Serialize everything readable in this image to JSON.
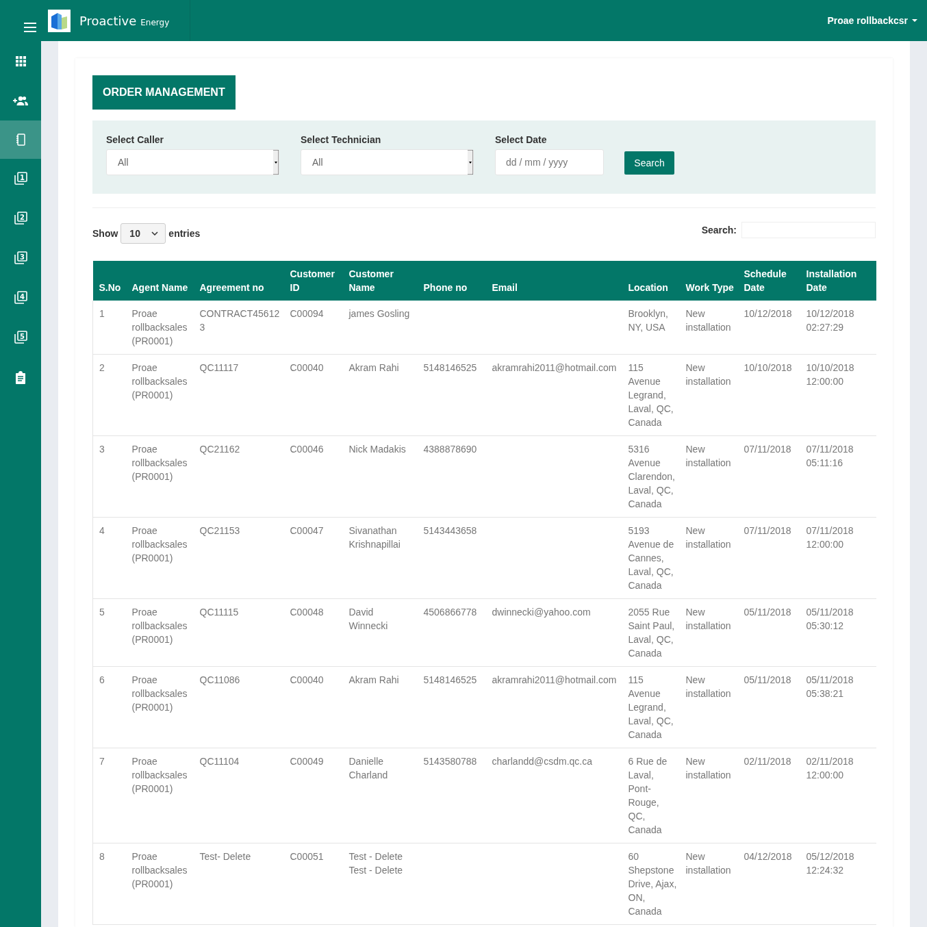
{
  "brand": {
    "name": "Proactive",
    "sub": "Energy"
  },
  "user": {
    "name": "Proae rollbackcsr"
  },
  "sidebar": {
    "items": [
      {
        "kind": "grid",
        "selected": false
      },
      {
        "kind": "people",
        "selected": false
      },
      {
        "kind": "notebook",
        "selected": true
      },
      {
        "kind": "numbered",
        "number": "1",
        "selected": false
      },
      {
        "kind": "numbered",
        "number": "2",
        "selected": false
      },
      {
        "kind": "numbered",
        "number": "3",
        "selected": false
      },
      {
        "kind": "numbered",
        "number": "4",
        "selected": false
      },
      {
        "kind": "numbered",
        "number": "5",
        "selected": false
      },
      {
        "kind": "clipboard",
        "selected": false
      }
    ]
  },
  "page_title": "ORDER MANAGEMENT",
  "filters": {
    "caller": {
      "label": "Select Caller",
      "value": "All"
    },
    "technician": {
      "label": "Select Technician",
      "value": "All"
    },
    "date": {
      "label": "Select Date",
      "placeholder": "dd / mm / yyyy"
    },
    "button": "Search"
  },
  "length": {
    "show": "Show",
    "value": "10",
    "entries": "entries"
  },
  "search": {
    "label": "Search:"
  },
  "table": {
    "columns": [
      "S.No",
      "Agent Name",
      "Agreement no",
      "Customer ID",
      "Customer Name",
      "Phone no",
      "Email",
      "Location",
      "Work Type",
      "Schedule Date",
      "Installation Date"
    ],
    "rows": [
      {
        "sno": "1",
        "agent": "Proae rollbacksales (PR0001)",
        "agreement": "CONTRACT456123",
        "customer_id": "C00094",
        "customer_name": "james Gosling",
        "location": "Brooklyn, NY, USA",
        "work_type": "New installation",
        "schedule": "10/12/2018",
        "installation": "10/12/2018 02:27:29"
      },
      {
        "sno": "2",
        "agent": "Proae rollbacksales (PR0001)",
        "agreement": "QC11117",
        "customer_id": "C00040",
        "customer_name": "Akram Rahi",
        "phone": "5148146525",
        "email": "akramrahi2011@hotmail.com",
        "location": "115 Avenue Legrand, Laval, QC, Canada",
        "work_type": "New installation",
        "schedule": "10/10/2018",
        "installation": "10/10/2018 12:00:00"
      },
      {
        "sno": "3",
        "agent": "Proae rollbacksales (PR0001)",
        "agreement": "QC21162",
        "customer_id": "C00046",
        "customer_name": "Nick Madakis",
        "phone": "4388878690",
        "location": "5316 Avenue Clarendon, Laval, QC, Canada",
        "work_type": "New installation",
        "schedule": "07/11/2018",
        "installation": "07/11/2018 05:11:16"
      },
      {
        "sno": "4",
        "agent": "Proae rollbacksales (PR0001)",
        "agreement": "QC21153",
        "customer_id": "C00047",
        "customer_name": "Sivanathan Krishnapillai",
        "phone": "5143443658",
        "location": "5193 Avenue de Cannes, Laval, QC, Canada",
        "work_type": "New installation",
        "schedule": "07/11/2018",
        "installation": "07/11/2018 12:00:00"
      },
      {
        "sno": "5",
        "agent": "Proae rollbacksales (PR0001)",
        "agreement": "QC11115",
        "customer_id": "C00048",
        "customer_name": "David Winnecki",
        "phone": "4506866778",
        "email": "dwinnecki@yahoo.com",
        "location": "2055 Rue Saint Paul, Laval, QC, Canada",
        "work_type": "New installation",
        "schedule": "05/11/2018",
        "installation": "05/11/2018 05:30:12"
      },
      {
        "sno": "6",
        "agent": "Proae rollbacksales (PR0001)",
        "agreement": "QC11086",
        "customer_id": "C00040",
        "customer_name": "Akram Rahi",
        "phone": "5148146525",
        "email": "akramrahi2011@hotmail.com",
        "location": "115 Avenue Legrand, Laval, QC, Canada",
        "work_type": "New installation",
        "schedule": "05/11/2018",
        "installation": "05/11/2018 05:38:21"
      },
      {
        "sno": "7",
        "agent": "Proae rollbacksales (PR0001)",
        "agreement": "QC11104",
        "customer_id": "C00049",
        "customer_name": "Danielle Charland",
        "phone": "5143580788",
        "email": "charlandd@csdm.qc.ca",
        "location": "6 Rue de Laval, Pont-Rouge, QC, Canada",
        "work_type": "New installation",
        "schedule": "02/11/2018",
        "installation": "02/11/2018 12:00:00"
      },
      {
        "sno": "8",
        "agent": "Proae rollbacksales (PR0001)",
        "agreement": "Test- Delete",
        "customer_id": "C00051",
        "customer_name": "Test - Delete Test - Delete",
        "location": "60 Shepstone Drive, Ajax, ON, Canada",
        "work_type": "New installation",
        "schedule": "04/12/2018",
        "installation": "05/12/2018 12:24:32"
      }
    ]
  }
}
